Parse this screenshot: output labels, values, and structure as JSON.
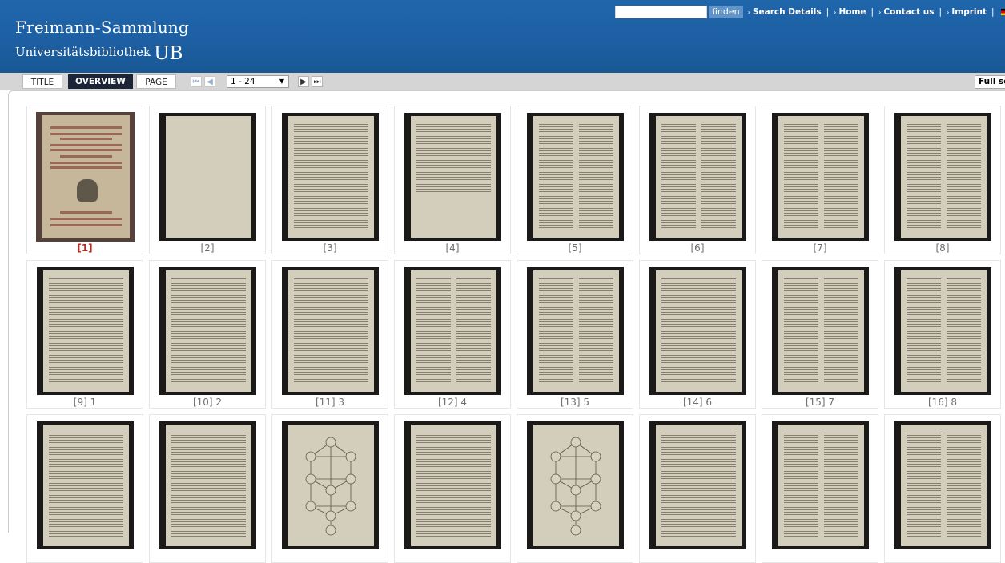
{
  "header": {
    "title": "Freimann-Sammlung",
    "subtitle": "Universitätsbibliothek",
    "subtitle_ub": "UB"
  },
  "topbar": {
    "search_value": "",
    "search_button": "finden",
    "links": [
      "Search Details",
      "Home",
      "Contact us",
      "Imprint"
    ],
    "separator": "|",
    "arrow": "›",
    "flag_icon": "german-flag-icon"
  },
  "toolbar": {
    "tabs": [
      "TITLE",
      "OVERVIEW",
      "PAGE"
    ],
    "active_tab": "OVERVIEW",
    "pager_value": "1 - 24",
    "fullscreen_label": "Full screen",
    "icons": {
      "first": "⏮",
      "prev": "◀",
      "next": "▶",
      "last": "⏭",
      "caret": "▼"
    }
  },
  "thumbnails": [
    {
      "label": "[1]",
      "selected": true,
      "kind": "title-page"
    },
    {
      "label": "[2]",
      "kind": "blank"
    },
    {
      "label": "[3]",
      "kind": "text"
    },
    {
      "label": "[4]",
      "kind": "text-short"
    },
    {
      "label": "[5]",
      "kind": "text-two"
    },
    {
      "label": "[6]",
      "kind": "text-two"
    },
    {
      "label": "[7]",
      "kind": "text-two"
    },
    {
      "label": "[8]",
      "kind": "text-two"
    },
    {
      "label": "[9] 1",
      "kind": "text"
    },
    {
      "label": "[10] 2",
      "kind": "text"
    },
    {
      "label": "[11] 3",
      "kind": "text"
    },
    {
      "label": "[12] 4",
      "kind": "text-two"
    },
    {
      "label": "[13] 5",
      "kind": "text-two"
    },
    {
      "label": "[14] 6",
      "kind": "text"
    },
    {
      "label": "[15] 7",
      "kind": "text-two"
    },
    {
      "label": "[16] 8",
      "kind": "text-two"
    },
    {
      "label": "",
      "kind": "text"
    },
    {
      "label": "",
      "kind": "text"
    },
    {
      "label": "",
      "kind": "tree"
    },
    {
      "label": "",
      "kind": "text"
    },
    {
      "label": "",
      "kind": "tree"
    },
    {
      "label": "",
      "kind": "text"
    },
    {
      "label": "",
      "kind": "text-two"
    },
    {
      "label": "",
      "kind": "text-two"
    }
  ]
}
